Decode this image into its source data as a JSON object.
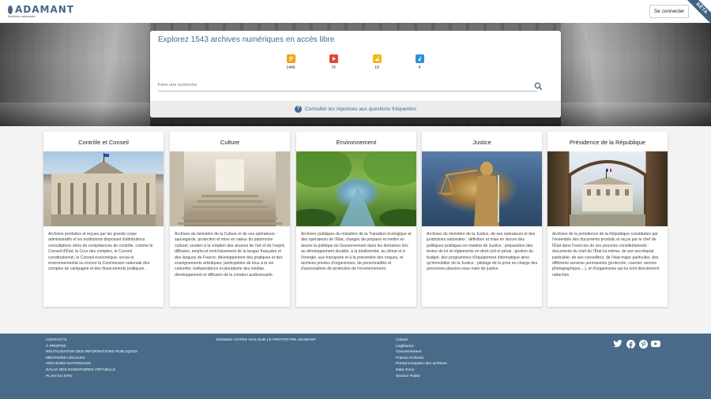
{
  "header": {
    "logo_text": "ADAMANT",
    "logo_subtitle": "Archives nationales",
    "login_label": "Se connecter",
    "beta_label": "BÊTA"
  },
  "search": {
    "title": "Explorez 1543 archives numériques en accès libre",
    "placeholder": "Faire une recherche",
    "faq_label": "Consulter les réponses aux questions fréquentes",
    "stats": [
      {
        "name": "documents",
        "count": "1446",
        "color": "#f0a21b",
        "icon": "document-icon"
      },
      {
        "name": "videos",
        "count": "74",
        "color": "#e2463b",
        "icon": "video-icon"
      },
      {
        "name": "images",
        "count": "19",
        "color": "#f2b51c",
        "icon": "image-icon"
      },
      {
        "name": "audio",
        "count": "4",
        "color": "#2f8fd6",
        "icon": "audio-icon"
      }
    ]
  },
  "cards": [
    {
      "title": "Contrôle et Conseil",
      "text": "Archives produites et reçues par les grands corps administratifs et les institutions disposant d'attributions consultatives et/ou de compétences de contrôle, comme le Conseil d'État, la Cour des comptes, le Conseil constitutionnel, le Conseil économique, social et environnemental ou encore la Commission nationale des comptes de campagne et des financements politiques."
    },
    {
      "title": "Culture",
      "text": "Archives du ministère de la Culture et de ses opérateurs : sauvegarde, protection et mise en valeur du patrimoine culturel; soutien à la création des œuvres de l'art et de l'esprit; diffusion, emploi et enrichissement de la langue française et des langues de France; développement des pratiques et des enseignements artistiques; participation de tous à la vie culturelle; indépendance et pluralisme des médias, développement et diffusion de la création audiovisuelle."
    },
    {
      "title": "Environnement",
      "text": "Archives publiques du ministère de la Transition écologique et des opérateurs de l'État, chargés de préparer et mettre en œuvre la politique du Gouvernement dans les domaines liés au développement durable, à la biodiversité, au climat et à l'énergie, aux transports et à la prévention des risques, et archives privées d'organismes, de personnalités et d'associations de protection de l'environnement."
    },
    {
      "title": "Justice",
      "text": "Archives du ministère de la Justice, de ses opérateurs et des juridictions nationales : définition et mise en œuvre des politiques publiques en matière de Justice ; préparation des textes de loi et règlements en droit civil et pénal ; gestion du budget, des programmes d'équipement informatique ainsi qu'immobilier de la Justice ; pilotage de la prise en charge des personnes placées sous main de justice."
    },
    {
      "title": "Présidence de la République",
      "text": "Archives de la présidence de la République constituées par l'ensemble des documents produits et reçus par le chef de l'État dans l'exercice de ses pouvoirs constitutionnels : documents du chef de l'État lui-même, de son secrétariat particulier, de ses conseillers, de l'état-major particulier, des différents services permanents (protocole, courrier, service photographique,...), et d'organismes qui lui sont directement rattachés."
    }
  ],
  "footer": {
    "col1": [
      "CONTACTS",
      "À PROPOS",
      "RÉUTILISATION DES INFORMATIONS PUBLIQUES",
      "MENTIONS LÉGALES",
      "ARCHIVES NATIONALES",
      "SALLE DES INVENTAIRES VIRTUELLE",
      "PLAN DU SITE"
    ],
    "col2": [
      "DONNEZ VOTRE AVIS SUR LE PROTOTYPE ADAMANT"
    ],
    "col3": [
      "Culture",
      "Legifrance",
      "Gouvernement",
      "France Archives",
      "Portail européen des archives",
      "Data Gouv",
      "Service Public"
    ],
    "social": [
      "twitter-icon",
      "facebook-icon",
      "pinterest-icon",
      "youtube-icon"
    ]
  }
}
